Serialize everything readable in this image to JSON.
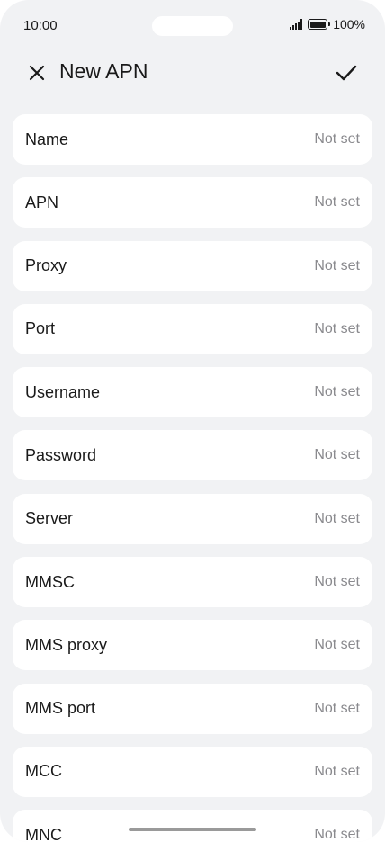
{
  "status_bar": {
    "time": "10:00",
    "battery_label": "100%"
  },
  "header": {
    "title": "New APN",
    "close_icon": "close-icon",
    "confirm_icon": "checkmark-icon"
  },
  "fields": [
    {
      "label": "Name",
      "value": "Not set"
    },
    {
      "label": "APN",
      "value": "Not set"
    },
    {
      "label": "Proxy",
      "value": "Not set"
    },
    {
      "label": "Port",
      "value": "Not set"
    },
    {
      "label": "Username",
      "value": "Not set"
    },
    {
      "label": "Password",
      "value": "Not set"
    },
    {
      "label": "Server",
      "value": "Not set"
    },
    {
      "label": "MMSC",
      "value": "Not set"
    },
    {
      "label": "MMS proxy",
      "value": "Not set"
    },
    {
      "label": "MMS port",
      "value": "Not set"
    },
    {
      "label": "MCC",
      "value": "Not set"
    },
    {
      "label": "MNC",
      "value": "Not set"
    }
  ],
  "colors": {
    "background": "#f1f2f4",
    "card": "#ffffff",
    "text_primary": "#1a1a1a",
    "text_secondary": "#8a8a8e"
  }
}
